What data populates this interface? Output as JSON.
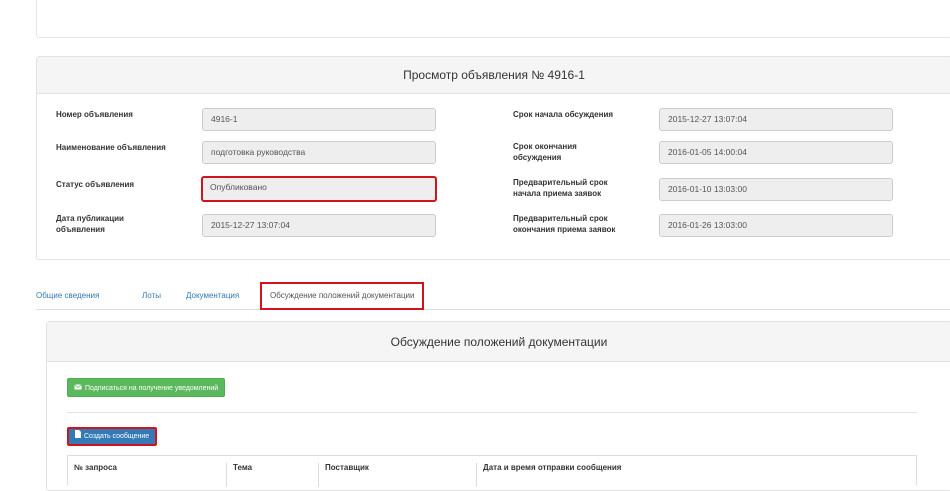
{
  "view_panel": {
    "title": "Просмотр объявления № 4916-1",
    "fields": [
      {
        "label": "Номер объявления",
        "value": "4916-1"
      },
      {
        "label": "Наименование объявления",
        "value": "подготовка руководства"
      },
      {
        "label": "Статус объявления",
        "value": "Опубликовано"
      },
      {
        "label": "Дата публикации объявления",
        "value": "2015-12-27 13:07:04"
      },
      {
        "label": "Срок начала обсуждения",
        "value": "2015-12-27 13:07:04"
      },
      {
        "label": "Срок окончания обсуждения",
        "value": "2016-01-05 14:00:04"
      },
      {
        "label": "Предварительный срок начала приема заявок",
        "value": "2016-01-10 13:03:00"
      },
      {
        "label": "Предварительный срок окончания приема заявок",
        "value": "2016-01-26 13:03:00"
      }
    ]
  },
  "tabs": [
    {
      "label": "Общие сведения"
    },
    {
      "label": "Лоты"
    },
    {
      "label": "Документация"
    },
    {
      "label": "Обсуждение положений документации"
    }
  ],
  "discussion": {
    "title": "Обсуждение положений документации",
    "subscribe_button": "Подписаться на получение уведомлений",
    "create_button": "Создать сообщение",
    "table_headers": [
      "№ запроса",
      "Тема",
      "Поставщик",
      "Дата и время отправки сообщения"
    ]
  },
  "icons": {
    "subscribe": "envelope-icon",
    "create": "file-icon"
  },
  "colors": {
    "highlight": "#d0141d",
    "green_button": "#5cb85c",
    "blue_button": "#337ab7",
    "link": "#337ab7"
  }
}
